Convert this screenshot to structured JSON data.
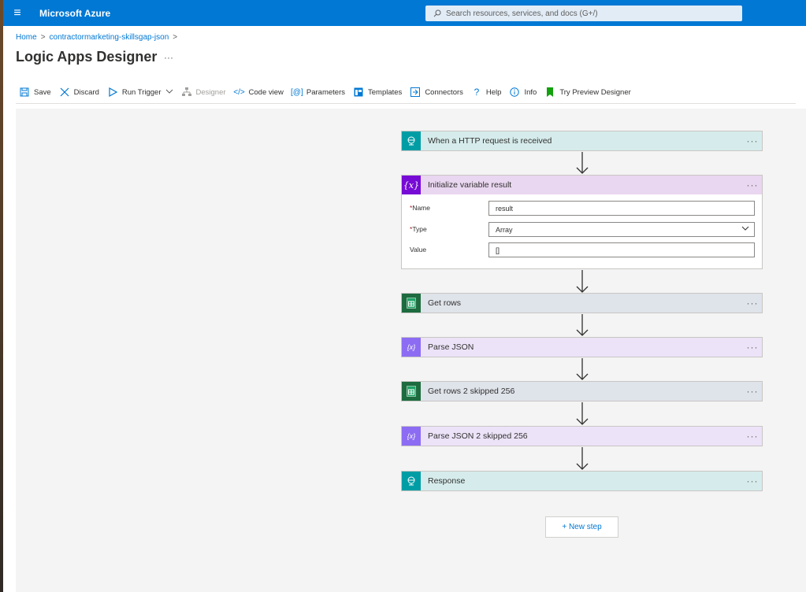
{
  "topbar": {
    "brand": "Microsoft Azure",
    "search_placeholder": "Search resources, services, and docs (G+/)"
  },
  "breadcrumb": {
    "home": "Home",
    "resource": "contractormarketing-skillsgap-json"
  },
  "page": {
    "title": "Logic Apps Designer",
    "more": "···"
  },
  "toolbar": {
    "save": "Save",
    "discard": "Discard",
    "run_trigger": "Run Trigger",
    "designer": "Designer",
    "code_view": "Code view",
    "parameters": "Parameters",
    "templates": "Templates",
    "connectors": "Connectors",
    "help": "Help",
    "info": "Info",
    "try_preview": "Try Preview Designer"
  },
  "steps": {
    "http_trigger": "When a HTTP request is received",
    "init_var": "Initialize variable result",
    "get_rows": "Get rows",
    "parse_json": "Parse JSON",
    "get_rows_2": "Get rows 2 skipped 256",
    "parse_json_2": "Parse JSON 2 skipped 256",
    "response": "Response",
    "more": "···"
  },
  "init_var_fields": {
    "required_mark": "*",
    "name_label": "Name",
    "name_value": "result",
    "type_label": "Type",
    "type_value": "Array",
    "value_label": "Value",
    "value_value": "[]"
  },
  "new_step": "+ New step",
  "colors": {
    "azure_blue": "#0078d4",
    "http_icon": "#009da5",
    "variable_icon": "#770bd6",
    "sheets_icon": "#1d6b3f",
    "json_icon": "#8c6cf3"
  }
}
